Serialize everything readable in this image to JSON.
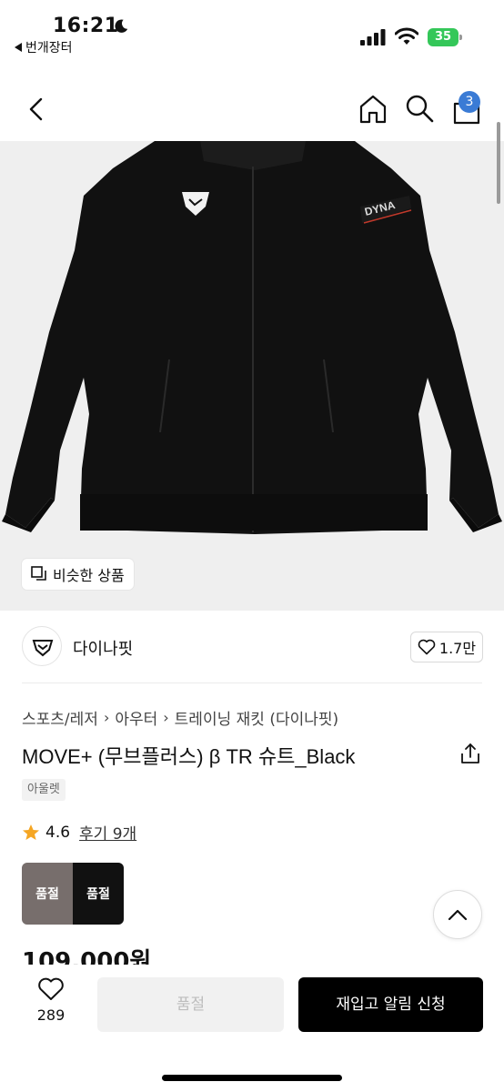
{
  "status_bar": {
    "time": "16:21",
    "back_app": "번개장터",
    "battery": "35"
  },
  "header": {
    "cart_count": "3"
  },
  "image": {
    "similar_label": "비슷한 상품"
  },
  "brand": {
    "name": "다이나핏",
    "likes": "1.7만"
  },
  "breadcrumb": [
    "스포츠/레저",
    "아우터",
    "트레이닝 재킷 (다이나핏)"
  ],
  "product": {
    "title": "MOVE+ (무브플러스) β TR 슈트_Black",
    "tag": "아울렛",
    "rating": "4.6",
    "review": "후기 9개",
    "price": "109,000원"
  },
  "colors": [
    {
      "name": "beige",
      "label": "품절",
      "color": "#b7a9a7"
    },
    {
      "name": "black",
      "label": "품절",
      "color": "#1b1b1b"
    }
  ],
  "bottom": {
    "wish_count": "289",
    "soldout_label": "품절",
    "restock_label": "재입고 알림 신청"
  }
}
